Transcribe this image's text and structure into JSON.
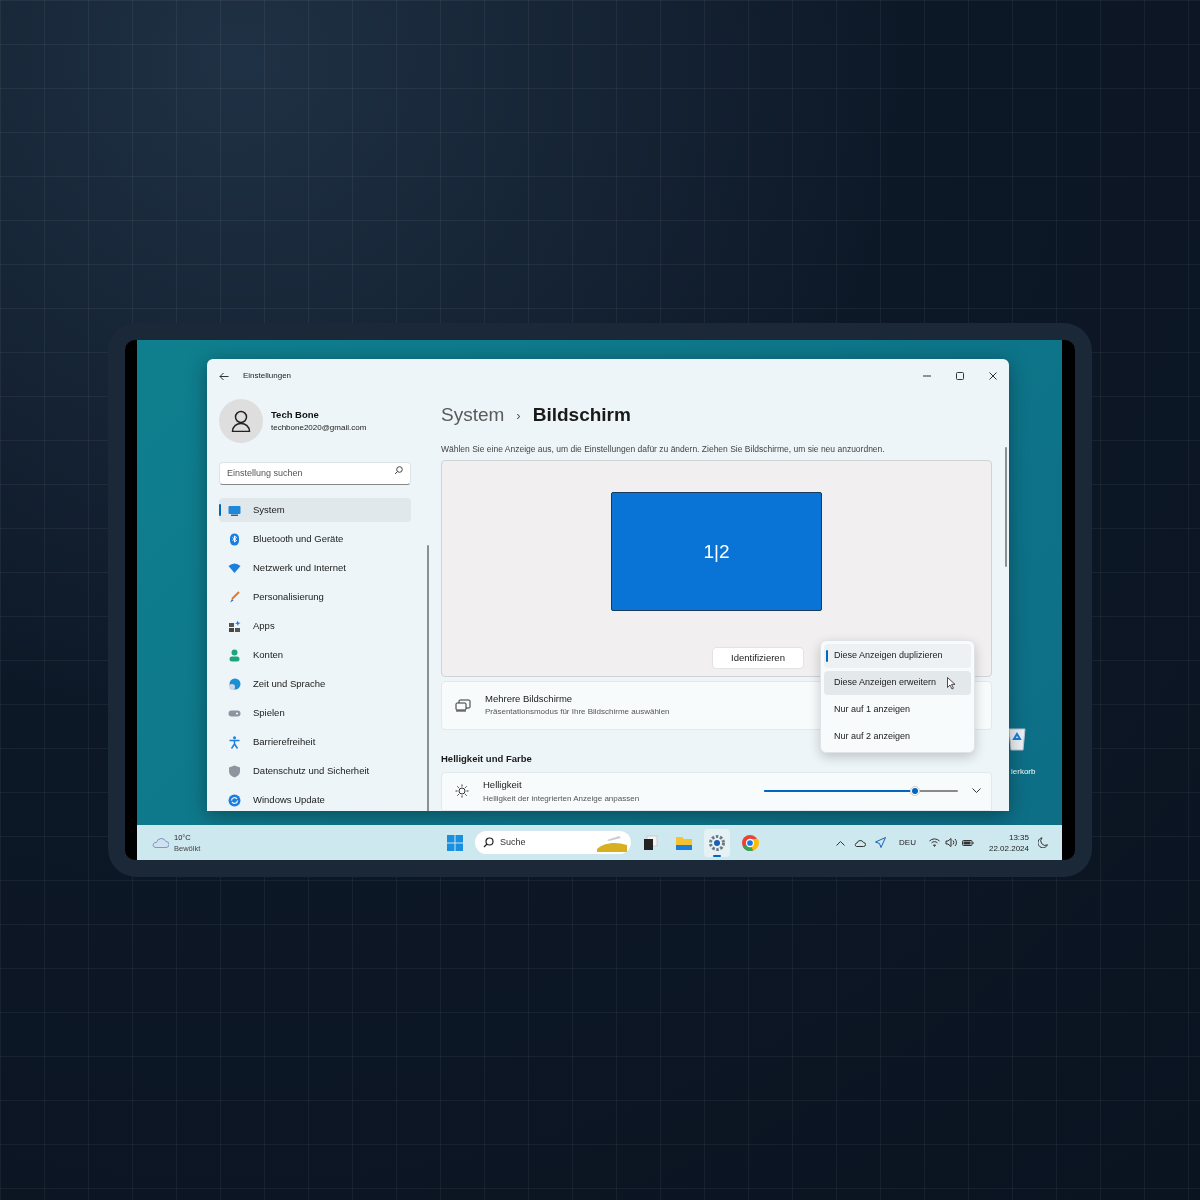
{
  "window": {
    "title": "Einstellungen"
  },
  "account": {
    "name": "Tech Bone",
    "email": "techbone2020@gmail.com"
  },
  "search": {
    "placeholder": "Einstellung suchen"
  },
  "sidebar": {
    "items": [
      {
        "label": "System",
        "kind": "system",
        "selected": true
      },
      {
        "label": "Bluetooth und Geräte",
        "kind": "bluetooth",
        "selected": false
      },
      {
        "label": "Netzwerk und Internet",
        "kind": "network",
        "selected": false
      },
      {
        "label": "Personalisierung",
        "kind": "personalization",
        "selected": false
      },
      {
        "label": "Apps",
        "kind": "apps",
        "selected": false
      },
      {
        "label": "Konten",
        "kind": "accounts",
        "selected": false
      },
      {
        "label": "Zeit und Sprache",
        "kind": "time",
        "selected": false
      },
      {
        "label": "Spielen",
        "kind": "gaming",
        "selected": false
      },
      {
        "label": "Barrierefreiheit",
        "kind": "accessibility",
        "selected": false
      },
      {
        "label": "Datenschutz und Sicherheit",
        "kind": "privacy",
        "selected": false
      },
      {
        "label": "Windows Update",
        "kind": "update",
        "selected": false
      }
    ]
  },
  "breadcrumb": {
    "parent": "System",
    "separator": "›",
    "current": "Bildschirm"
  },
  "description": "Wählen Sie eine Anzeige aus, um die Einstellungen dafür zu ändern. Ziehen Sie Bildschirme, um sie neu anzuordnen.",
  "arrangement": {
    "monitor_label": "1|2",
    "identify_button": "Identifizieren"
  },
  "dropdown": {
    "options": [
      {
        "label": "Diese Anzeigen duplizieren",
        "selected": true,
        "hovered": false
      },
      {
        "label": "Diese Anzeigen erweitern",
        "selected": false,
        "hovered": true
      },
      {
        "label": "Nur auf 1 anzeigen",
        "selected": false,
        "hovered": false
      },
      {
        "label": "Nur auf 2 anzeigen",
        "selected": false,
        "hovered": false
      }
    ]
  },
  "multiple_displays": {
    "title": "Mehrere Bildschirme",
    "subtitle": "Präsentationsmodus für Ihre Bildschirme auswählen"
  },
  "section_heading": "Helligkeit und Farbe",
  "brightness": {
    "title": "Helligkeit",
    "subtitle": "Helligkeit der integrierten Anzeige anpassen",
    "level": 0.78
  },
  "desktop_icon": {
    "label": "ierkorb"
  },
  "taskbar": {
    "weather": {
      "temperature": "10°C",
      "condition": "Bewölkt"
    },
    "search_placeholder": "Suche",
    "apps": [
      {
        "kind": "start",
        "active": false
      },
      {
        "kind": "taskview",
        "active": false
      },
      {
        "kind": "explorer",
        "active": false
      },
      {
        "kind": "settings",
        "active": true
      },
      {
        "kind": "chrome",
        "active": false
      }
    ],
    "language": "DEU",
    "time": "13:35",
    "date": "22.02.2024"
  }
}
